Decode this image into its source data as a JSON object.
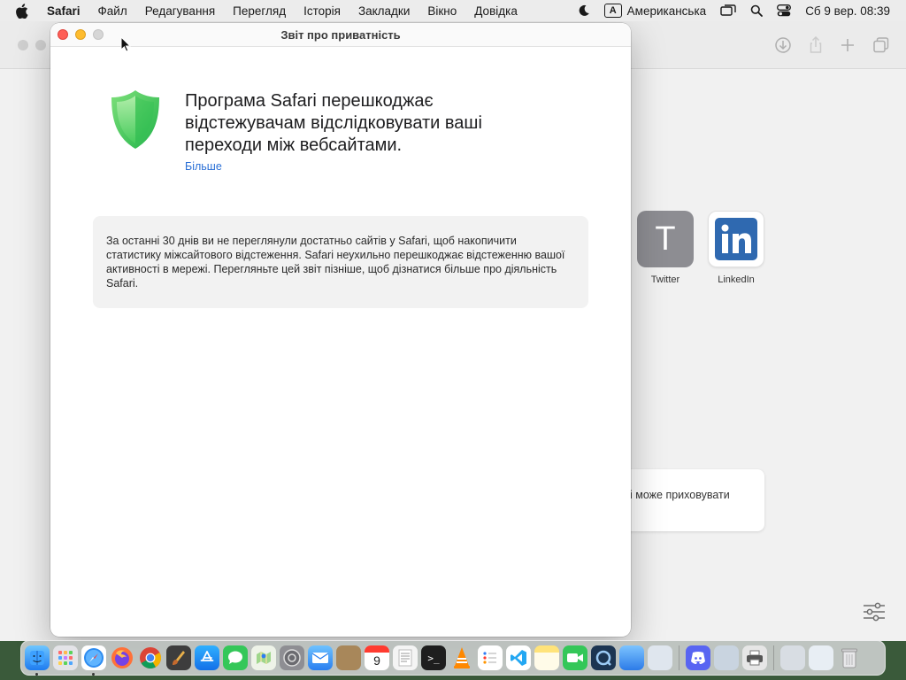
{
  "menubar": {
    "app_name": "Safari",
    "items": [
      "Файл",
      "Редагування",
      "Перегляд",
      "Історія",
      "Закладки",
      "Вікно",
      "Довідка"
    ],
    "keyboard_badge": "A",
    "keyboard_layout": "Американська",
    "datetime": "Сб 9 вер.  08:39"
  },
  "background_window": {
    "favorites": [
      {
        "label": "Twitter",
        "letter": "T"
      },
      {
        "label": "LinkedIn"
      }
    ],
    "card_text": "і може приховувати"
  },
  "privacy_report": {
    "title": "Звіт про приватність",
    "headline": "Програма Safari перешкоджає відстежувачам відслідковувати ваші переходи між вебсайтами.",
    "more_link": "Більше",
    "info_text": "За останні 30 днів ви не переглянули достатньо сайтів у Safari, щоб накопичити статистику міжсайтового відстеження. Safari неухильно перешкоджає відстеженню вашої активності в мережі. Перегляньте цей звіт пізніше, щоб дізнатися більше про діяльність Safari."
  },
  "dock": {
    "apps": [
      "finder-icon",
      "launchpad-icon",
      "safari-icon",
      "firefox-icon",
      "chrome-icon",
      "paintbrush-icon",
      "app-store-icon",
      "messages-icon",
      "maps-icon",
      "system-settings-icon",
      "mail-icon",
      "notes-brown-icon",
      "calendar-icon",
      "textedit-icon",
      "terminal-icon",
      "vlc-icon",
      "reminders-icon",
      "vscode-icon",
      "notes-icon",
      "facetime-icon",
      "quicktime-icon",
      "migration-icon",
      "preview-icon",
      "discord-icon",
      "screenshot-icon",
      "printer-icon",
      "network-folder-icon",
      "preview-folder-icon",
      "trash-icon"
    ],
    "calendar_day": "9"
  },
  "colors": {
    "close": "#fe5f57",
    "minimize": "#febc2e",
    "link": "#2a6fd6",
    "shield_green": "#34c759"
  }
}
